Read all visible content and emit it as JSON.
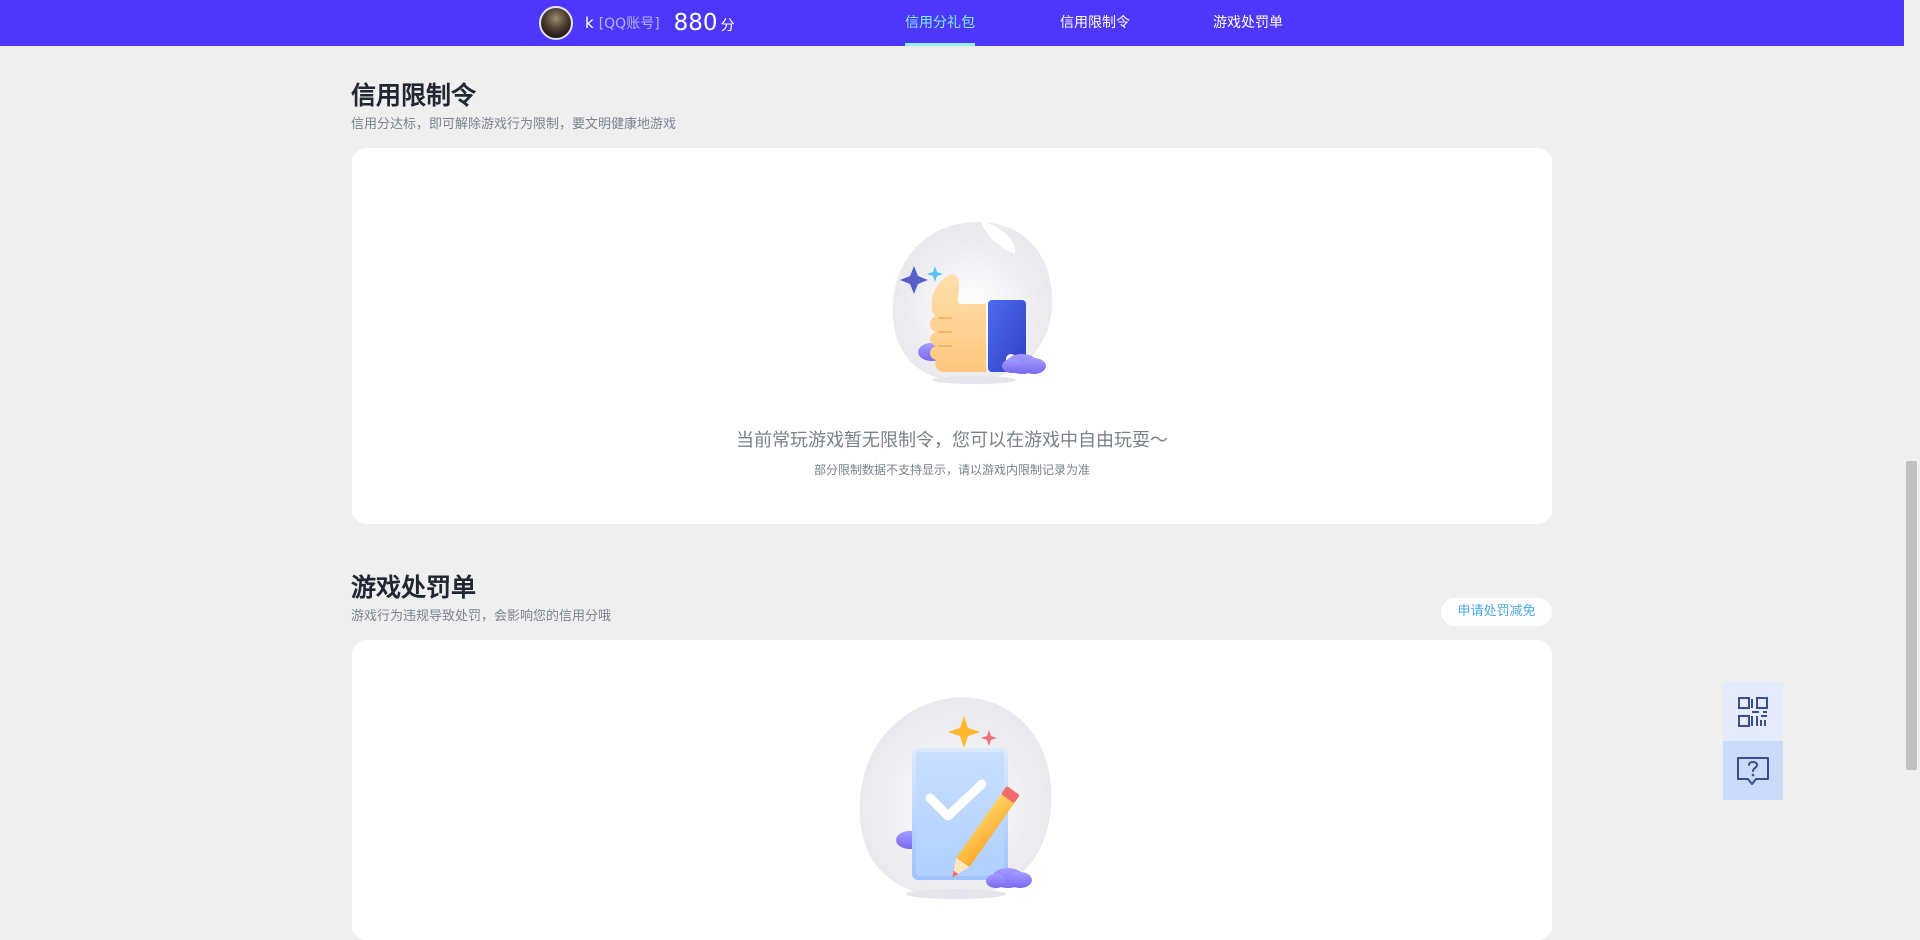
{
  "header": {
    "username": "k",
    "account_type": "[QQ账号]",
    "score": "880",
    "score_unit": "分",
    "tabs": [
      {
        "label": "信用分礼包",
        "active": true
      },
      {
        "label": "信用限制令",
        "active": false
      },
      {
        "label": "游戏处罚单",
        "active": false
      }
    ]
  },
  "restrictions": {
    "title": "信用限制令",
    "subtitle": "信用分达标，即可解除游戏行为限制，要文明健康地游戏",
    "empty_text": "当前常玩游戏暂无限制令，您可以在游戏中自由玩耍～",
    "empty_note": "部分限制数据不支持显示，请以游戏内限制记录为准"
  },
  "penalties": {
    "title": "游戏处罚单",
    "subtitle": "游戏行为违规导致处罚，会影响您的信用分哦",
    "apply_button": "申请处罚减免"
  },
  "float_tools": [
    {
      "icon": "qr-code-icon"
    },
    {
      "icon": "feedback-question-icon"
    }
  ],
  "colors": {
    "nav_bg": "#4e37fb",
    "active_tab": "#7ff0ff",
    "accent_blue": "#4ba6e8",
    "page_bg": "#efefef"
  }
}
